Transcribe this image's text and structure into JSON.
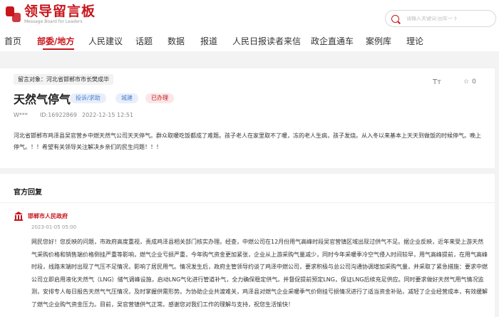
{
  "header": {
    "logo_text": "领导留言板",
    "logo_subtext": "Message Board for Leaders",
    "search_placeholder": "请输入关键词 回车一下"
  },
  "nav": {
    "items": [
      {
        "label": "首页",
        "active": false
      },
      {
        "label": "部委/地方",
        "active": true
      },
      {
        "label": "人民建议",
        "active": false
      },
      {
        "label": "话题",
        "active": false
      },
      {
        "label": "数据",
        "active": false
      },
      {
        "label": "报道",
        "active": false
      },
      {
        "label": "人民日报读者来信",
        "active": false
      },
      {
        "label": "政企直通车",
        "active": false
      },
      {
        "label": "案例库",
        "active": false
      },
      {
        "label": "理论",
        "active": false
      }
    ]
  },
  "message": {
    "to": "留言对象：河北省邯郸市市长樊成华",
    "title": "天然气停气",
    "tags": [
      "投诉/求助",
      "城建",
      "已办理"
    ],
    "author": "W***",
    "id": "ID:16922869",
    "datetime": "2022-12-15 12:51",
    "font_icon": "Tт",
    "star_icon": "☆",
    "star_count": "0",
    "content": "河北省邯郸市鸡泽县吴官营乡中燃天然气公司天天停气。群众取暖吃饭都成了难题。孩子老人在家里取不了暖，冻的老人生病，孩子发烧。从入冬以来基本上天天到做饭的时候停气。晚上停气。！！希望有关领导关注解决乡亲们的民生问题！！！"
  },
  "reply": {
    "section_title": "官方回复",
    "org": "邯郸市人民政府",
    "date": "2023-01-05 05:00",
    "text": "网民您好！您反映的问题，市政府高度重视，责成鸡泽县相关部门核实办理。经查，中燃公司在12月份用气高峰时段吴官营镇区域出现过供气不足。据企业反映，近年来受上游天然气采购价格和销售端价格倒挂严重等影响，燃气企业亏损严重，今年购气资金更加紧张，企业从上游采购气量减少，同时今年采暖季冷空气侵入时间较早，用气高峰提前，在用气高峰时段，线路末端时出现了气压不足情况，影响了居民用气。情况发生后，政府主管领导约谈了鸡泽中燃公司，要求积极与总公司沟通协调增加采购气量，并采取了紧急措施：要求中燃公司立即启用液化天然气（LNG）储气调峰设施，启动LNG气化进行管道补气，全力确保稳定供气。并督促提前预定LNG，保证LNG后续充足供应。同时要求做好天然气用气情况监测，安排专人每日报告天然气气压情况，及时掌握供需形势。为协助企业共渡难关，鸡泽县对燃气企业采暖季气价倒挂亏损情况进行了适当资金补贴，减轻了企业经营成本，有效缓解了燃气企业购气资金压力。目前，吴官营镇供气正常。感谢您对我们工作的理解与支持，祝您生活愉快！"
  }
}
